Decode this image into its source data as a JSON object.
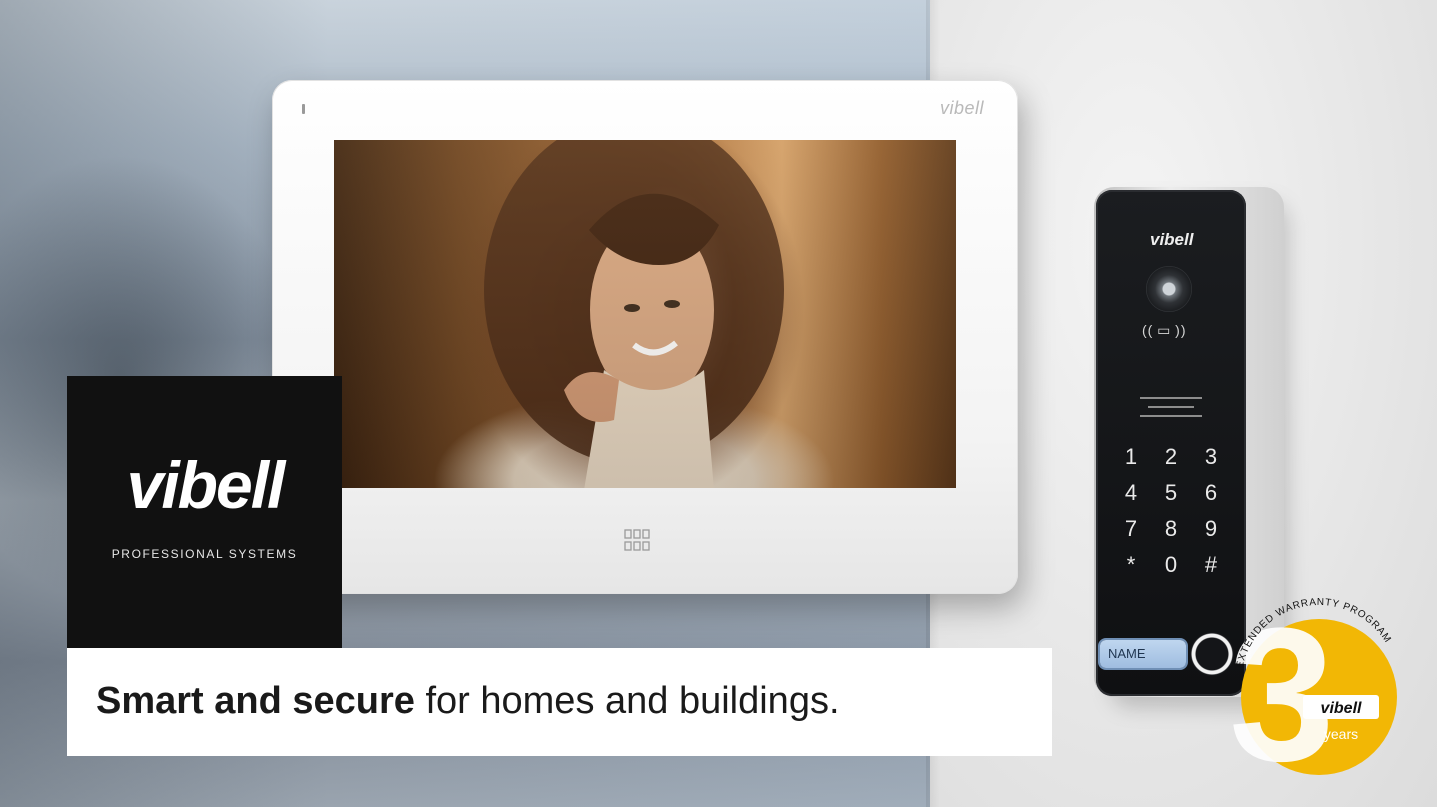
{
  "logo": {
    "wordmark": "vibell",
    "subtitle": "PROFESSIONAL SYSTEMS"
  },
  "tagline": {
    "bold": "Smart and secure",
    "rest": " for homes and buildings."
  },
  "monitor": {
    "brand": "vibell",
    "menu_icon": "grid-menu-icon"
  },
  "door_station": {
    "brand": "vibell",
    "rfid_symbol": "(( ▭ ))",
    "keys": [
      "1",
      "2",
      "3",
      "4",
      "5",
      "6",
      "7",
      "8",
      "9",
      "*",
      "0",
      "#"
    ],
    "name_plate": "NAME"
  },
  "badge": {
    "number": "3",
    "arc_text": "EXTENDED WARRANTY PROGRAM",
    "brand": "vibell",
    "years": "years",
    "color": "#f2b705"
  },
  "colors": {
    "logo_bg": "#111111",
    "tagline_bg": "#ffffff",
    "text_dark": "#1a1a1a"
  }
}
